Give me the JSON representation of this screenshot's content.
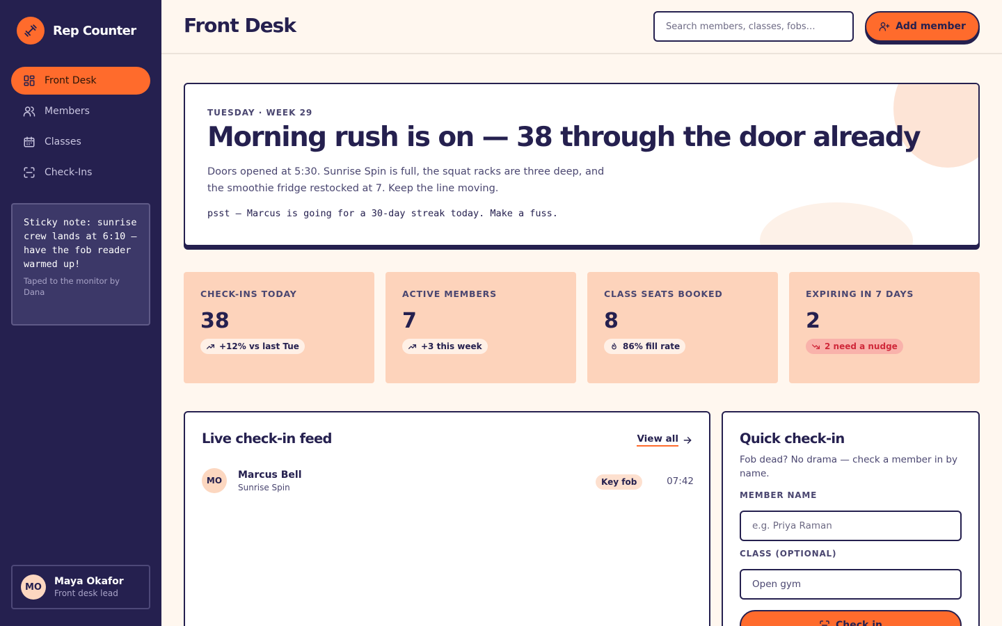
{
  "colors": {
    "sidebar_bg": "#25204f",
    "accent": "#ff6b2c",
    "page_bg": "#fff7ef",
    "stat_bg": "#fdd3bb",
    "warn": "#d0283a"
  },
  "brand": {
    "name": "Rep Counter",
    "icon": "dumbbell-icon"
  },
  "sidebar": {
    "items": [
      {
        "label": "Front Desk",
        "icon": "dashboard-grid-icon",
        "active": true
      },
      {
        "label": "Members",
        "icon": "users-icon",
        "active": false
      },
      {
        "label": "Classes",
        "icon": "calendar-icon",
        "active": false
      },
      {
        "label": "Check-Ins",
        "icon": "scan-icon",
        "active": false
      }
    ],
    "sticky_note": {
      "text": "Sticky note: sunrise crew lands at 6:10 — have the fob reader warmed up!",
      "by": "Taped to the monitor by Dana"
    },
    "user": {
      "initials": "MO",
      "name": "Maya Okafor",
      "role": "Front desk lead"
    }
  },
  "header": {
    "title": "Front Desk",
    "search_placeholder": "Search members, classes, fobs…",
    "add_member_label": "Add member"
  },
  "hero": {
    "eyebrow": "TUESDAY · WEEK 29",
    "title": "Morning rush is on — 38 through the door already",
    "body": "Doors opened at 5:30. Sunrise Spin is full, the squat racks are three deep, and the smoothie fridge restocked at 7. Keep the line moving.",
    "psst": "psst — Marcus is going for a 30-day streak today. Make a fuss."
  },
  "stats": [
    {
      "label": "CHECK-INS TODAY",
      "value": "38",
      "badge": "+12% vs last Tue",
      "badge_icon": "trend-up-icon"
    },
    {
      "label": "ACTIVE MEMBERS",
      "value": "7",
      "badge": "+3 this week",
      "badge_icon": "trend-up-icon"
    },
    {
      "label": "CLASS SEATS BOOKED",
      "value": "8",
      "badge": "86% fill rate",
      "badge_icon": "flame-icon"
    },
    {
      "label": "EXPIRING IN 7 DAYS",
      "value": "2",
      "badge": "2 need a nudge",
      "badge_icon": "trend-down-icon"
    }
  ],
  "feed": {
    "title": "Live check-in feed",
    "view_all": "View all",
    "rows": [
      {
        "initials": "MO",
        "name": "Marcus Bell",
        "class": "Sunrise Spin",
        "method": "Key fob",
        "time": "07:42"
      }
    ]
  },
  "quick_checkin": {
    "title": "Quick check-in",
    "description": "Fob dead? No drama — check a member in by name.",
    "member_label": "MEMBER NAME",
    "member_placeholder": "e.g. Priya Raman",
    "class_label": "CLASS (OPTIONAL)",
    "class_value": "Open gym",
    "button_label": "Check in"
  }
}
